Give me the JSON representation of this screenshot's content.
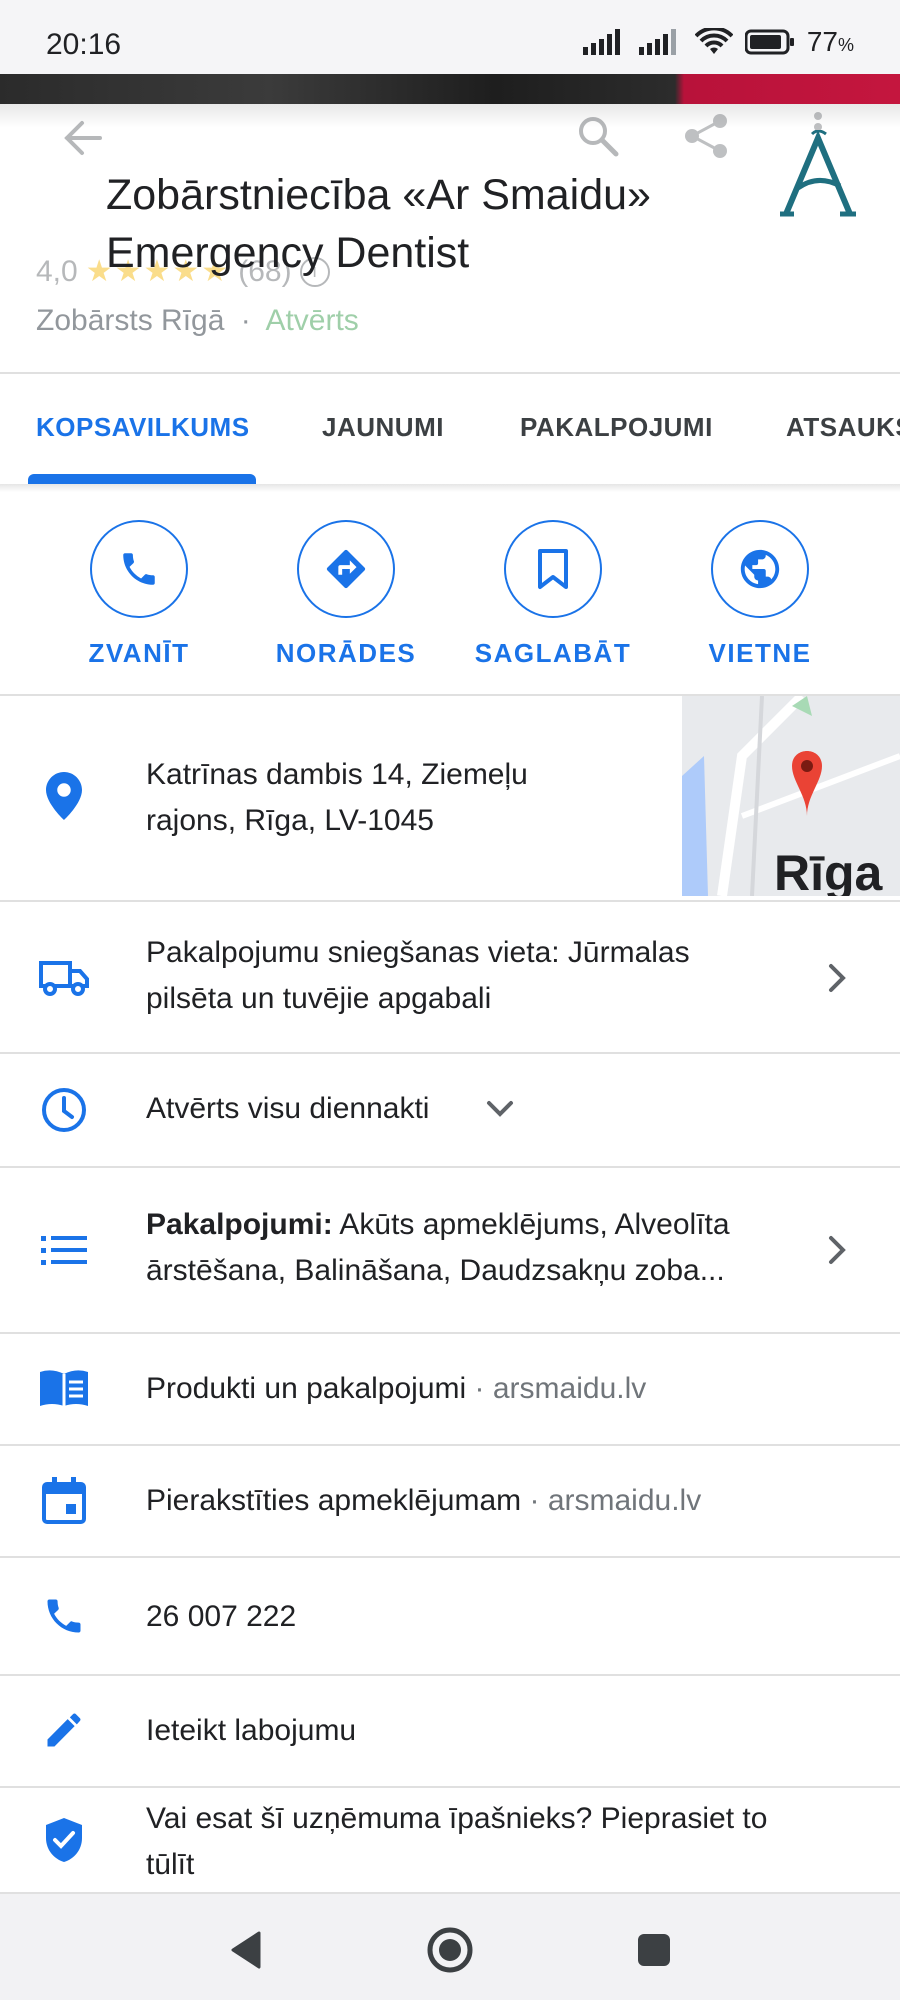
{
  "status_bar": {
    "time": "20:16",
    "battery": "77",
    "battery_unit": "%"
  },
  "header": {
    "title": "Zobārstniecība «Ar Smaidu» Emergency Dentist",
    "rating": "4,0",
    "stars": "★★★★★",
    "review_count": "(68)",
    "category": "Zobārsts Rīgā",
    "separator": "·",
    "open_status": "Atvērts",
    "logo_letter": "A"
  },
  "tabs": [
    {
      "label": "KOPSAVILKUMS",
      "active": true
    },
    {
      "label": "JAUNUMI",
      "active": false
    },
    {
      "label": "PAKALPOJUMI",
      "active": false
    },
    {
      "label": "ATSAUKS",
      "active": false
    }
  ],
  "actions": [
    {
      "label": "ZVANĪT",
      "icon": "phone-icon"
    },
    {
      "label": "NORĀDES",
      "icon": "directions-icon"
    },
    {
      "label": "SAGLABĀT",
      "icon": "bookmark-icon"
    },
    {
      "label": "VIETNE",
      "icon": "globe-icon"
    }
  ],
  "details": {
    "address_line1": "Katrīnas dambis 14, Ziemeļu",
    "address_line2": "rajons, Rīga, LV-1045",
    "map_label": "Rīga",
    "service_area_line1": "Pakalpojumu sniegšanas vieta: Jūrmalas",
    "service_area_line2": "pilsēta un tuvējie apgabali",
    "hours": "Atvērts visu diennakti",
    "services_label": "Pakalpojumi:",
    "services_line1": " Akūts apmeklējums, Alveolīta",
    "services_line2": "ārstēšana, Balināšana, Daudzsakņu zoba...",
    "products": "Produkti un pakalpojumi",
    "products_site": "arsmaidu.lv",
    "booking": "Pierakstīties apmeklējumam",
    "booking_site": "arsmaidu.lv",
    "dot": "·",
    "phone": "26 007 222",
    "suggest_edit": "Ieteikt labojumu",
    "claim_line1": "Vai esat šī uzņēmuma īpašnieks? Pieprasiet to",
    "claim_line2": "tūlīt"
  },
  "colors": {
    "accent": "#1a73e8",
    "open_green": "#188038",
    "star": "#f4b400",
    "logo": "#1f6f80"
  }
}
